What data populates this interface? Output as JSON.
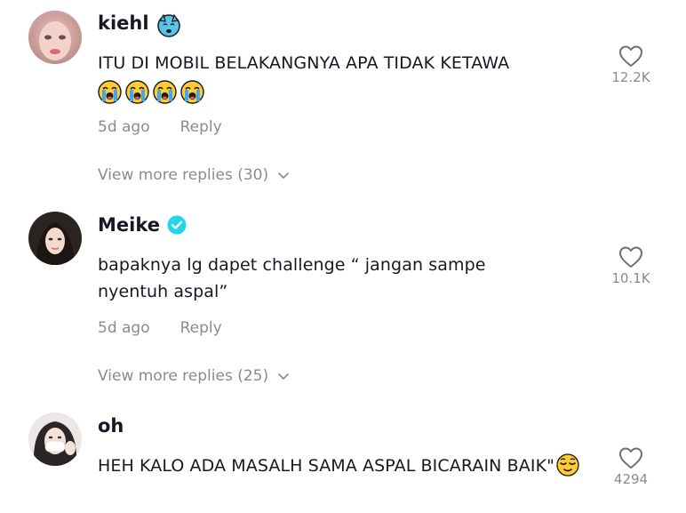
{
  "comments": [
    {
      "username": "kiehl",
      "badge_icon": "crying-cat-emoji-icon",
      "text": "ITU DI MOBIL BELAKANGNYA APA TIDAK KETAWA",
      "emojis": [
        "loudly-crying-face",
        "loudly-crying-face",
        "loudly-crying-face",
        "loudly-crying-face"
      ],
      "time": "5d ago",
      "reply_label": "Reply",
      "likes": "12.2K",
      "view_more": "View more replies (30)"
    },
    {
      "username": "Meike",
      "badge_icon": "verified-badge-icon",
      "text": "bapaknya lg dapet challenge “ jangan sampe nyentuh aspal”",
      "time": "5d ago",
      "reply_label": "Reply",
      "likes": "10.1K",
      "view_more": "View more replies (25)"
    },
    {
      "username": "oh",
      "text": "HEH KALO ADA MASALH SAMA ASPAL BICARAIN BAIK\"",
      "trailing_emoji": "relieved-face",
      "likes": "4294"
    }
  ],
  "colors": {
    "primary_text": "#161823",
    "secondary_text": "#8a8b91",
    "verified": "#20d5ec"
  }
}
